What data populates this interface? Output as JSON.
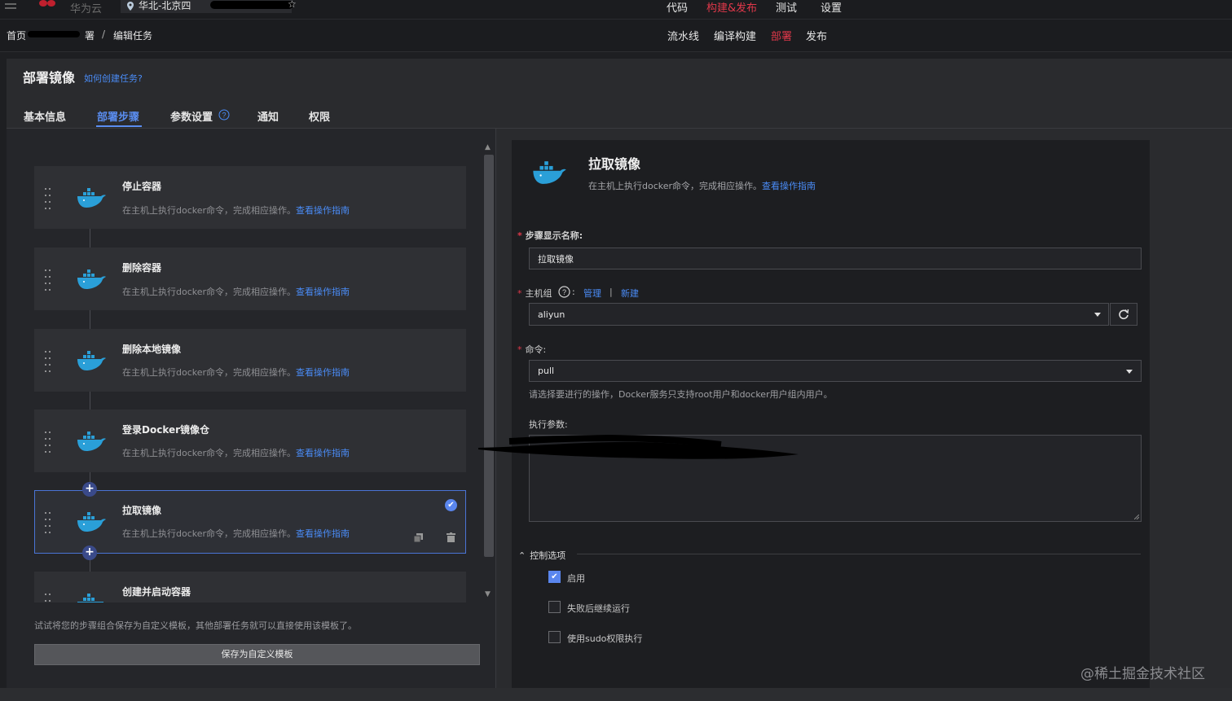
{
  "topbar": {
    "brand": "华为云",
    "region": "华北-北京四",
    "nav": [
      {
        "label": "代码",
        "active": false
      },
      {
        "label": "构建&发布",
        "active": true
      },
      {
        "label": "测试",
        "active": false
      },
      {
        "label": "设置",
        "active": false
      }
    ]
  },
  "subbar": {
    "breadcrumb_home": "首页",
    "breadcrumb_mid_tail": "署",
    "breadcrumb_sep": "/",
    "breadcrumb_current": "编辑任务",
    "nav": [
      {
        "label": "流水线",
        "active": false
      },
      {
        "label": "编译构建",
        "active": false
      },
      {
        "label": "部署",
        "active": true
      },
      {
        "label": "发布",
        "active": false
      }
    ]
  },
  "page": {
    "title": "部署镜像",
    "help_link": "如何创建任务?",
    "tabs": [
      "基本信息",
      "部署步骤",
      "参数设置",
      "通知",
      "权限"
    ],
    "active_tab": "部署步骤"
  },
  "steps": [
    {
      "name": "停止容器",
      "desc": "在主机上执行docker命令，完成相应操作。",
      "link": "查看操作指南"
    },
    {
      "name": "删除容器",
      "desc": "在主机上执行docker命令，完成相应操作。",
      "link": "查看操作指南"
    },
    {
      "name": "删除本地镜像",
      "desc": "在主机上执行docker命令，完成相应操作。",
      "link": "查看操作指南"
    },
    {
      "name": "登录Docker镜像仓",
      "desc": "在主机上执行docker命令，完成相应操作。",
      "link": "查看操作指南"
    },
    {
      "name": "拉取镜像",
      "desc": "在主机上执行docker命令，完成相应操作。",
      "link": "查看操作指南",
      "selected": true
    },
    {
      "name": "创建并启动容器"
    }
  ],
  "left_footer": {
    "hint": "试试将您的步骤组合保存为自定义模板，其他部署任务就可以直接使用该模板了。",
    "save_button": "保存为自定义模板"
  },
  "detail": {
    "title": "拉取镜像",
    "desc": "在主机上执行docker命令，完成相应操作。",
    "desc_link": "查看操作指南",
    "step_name_label": "步骤显示名称:",
    "step_name_value": "拉取镜像",
    "host_group_label": "主机组",
    "host_group_manage": "管理",
    "host_group_sep": "|",
    "host_group_new": "新建",
    "host_group_value": "aliyun",
    "command_label": "命令:",
    "command_value": "pull",
    "command_help": "请选择要进行的操作，Docker服务只支持root用户和docker用户组内用户。",
    "params_label": "执行参数:",
    "control_label": "控制选项",
    "options": [
      {
        "label": "启用",
        "checked": true
      },
      {
        "label": "失败后继续运行",
        "checked": false
      },
      {
        "label": "使用sudo权限执行",
        "checked": false
      }
    ]
  },
  "watermark": "@稀土掘金技术社区",
  "colors": {
    "accent_red": "#e0384a",
    "accent_blue": "#5a8df0",
    "link_blue": "#4a8cf7",
    "docker_blue": "#2a9fd8"
  }
}
